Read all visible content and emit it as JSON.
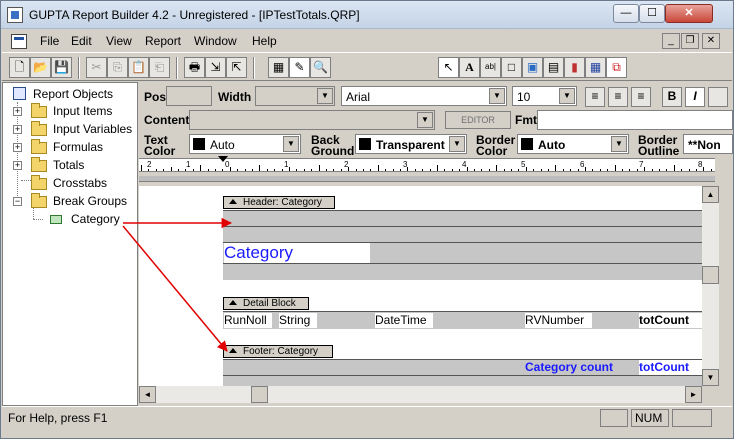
{
  "window": {
    "title": "GUPTA Report Builder 4.2 - Unregistered - [IPTestTotals.QRP]",
    "min_glyph": "—",
    "max_glyph": "☐",
    "close_glyph": "✕"
  },
  "menu": {
    "items": [
      "File",
      "Edit",
      "View",
      "Report",
      "Window",
      "Help"
    ],
    "mdi_min": "_",
    "mdi_restore": "❐",
    "mdi_close": "✕"
  },
  "toolbar": {
    "new": "🗋",
    "open": "📂",
    "save": "💾",
    "cut": "✂",
    "copy": "⎘",
    "paste": "📋",
    "paste_special": "⎗",
    "print": "🖶",
    "import": "⇲",
    "export": "⇱",
    "design": "▦",
    "edit_design": "✎",
    "preview": "🔍",
    "pointer": "↖",
    "text": "A",
    "field": "ab|",
    "frame": "□",
    "picture": "▣",
    "table": "▤",
    "chart": "▮",
    "crosstab": "▦",
    "breaks": "⧉"
  },
  "tree": {
    "root": "Report Objects",
    "items": [
      "Input Items",
      "Input Variables",
      "Formulas",
      "Totals",
      "Crosstabs",
      "Break Groups"
    ],
    "child": "Category",
    "plus": "+",
    "minus": "−"
  },
  "props": {
    "pos_label": "Pos",
    "width_label": "Width",
    "font": "Arial",
    "size": "10",
    "content_label": "Content",
    "editor_label": "EDITOR",
    "fmt_label": "Fmt",
    "text_color_label1": "Text",
    "text_color_label2": "Color",
    "text_color": "Auto",
    "background_label1": "Back",
    "background_label2": "Ground",
    "background": "Transparent",
    "border_color_label1": "Border",
    "border_color_label2": "Color",
    "border_color": "Auto",
    "border_outline_label1": "Border",
    "border_outline_label2": "Outline",
    "border_outline": "**Non",
    "dd_glyph": "▼",
    "bold": "B",
    "italic": "I"
  },
  "ruler": {
    "marks": [
      "2",
      "1",
      "0",
      "1",
      "2",
      "3",
      "4",
      "5",
      "6",
      "7",
      "8"
    ]
  },
  "bands": {
    "header_label": "Header: Category",
    "header_field": "Category",
    "detail_label": "Detail Block",
    "detail_fields": [
      "RunNoll",
      "String",
      "DateTime",
      "RVNumber",
      "totCount"
    ],
    "footer_label": "Footer: Category",
    "footer_text": "Category count",
    "footer_field": "totCount"
  },
  "scroll": {
    "up": "▲",
    "down": "▼",
    "left": "◄",
    "right": "►"
  },
  "status": {
    "help": "For Help, press F1",
    "num": "NUM"
  },
  "colors": {
    "arrow": "#e00000",
    "field_blue": "#1a1aff"
  }
}
